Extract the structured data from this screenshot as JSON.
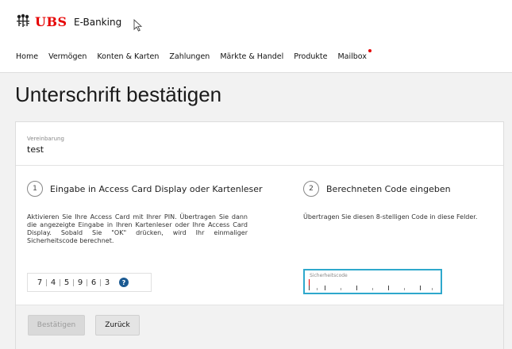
{
  "header": {
    "logo_text": "UBS",
    "app_name": "E-Banking",
    "brand_color": "#e60000"
  },
  "nav": {
    "items": [
      "Home",
      "Vermögen",
      "Konten & Karten",
      "Zahlungen",
      "Märkte & Handel",
      "Produkte",
      "Mailbox"
    ]
  },
  "page": {
    "title": "Unterschrift bestätigen"
  },
  "agreement": {
    "label": "Vereinbarung",
    "value": "test"
  },
  "step1": {
    "number": "1",
    "title": "Eingabe in Access Card Display oder Kartenleser",
    "text": "Aktivieren Sie Ihre Access Card mit Ihrer PIN. Übertragen Sie dann die angezeigte Eingabe in Ihren Kartenleser oder Ihre Access Card Display. Sobald Sie \"OK\" drücken, wird Ihr einmaliger Sicherheitscode berechnet.",
    "digits": [
      "7",
      "4",
      "5",
      "9",
      "6",
      "3"
    ],
    "help_icon": "question-circle-icon"
  },
  "step2": {
    "number": "2",
    "title": "Berechneten Code eingeben",
    "text": "Übertragen Sie diesen 8-stelligen Code in diese Felder.",
    "field_label": "Sicherheitscode",
    "field_value": ""
  },
  "buttons": {
    "confirm": "Bestätigen",
    "back": "Zurück"
  },
  "colors": {
    "focus": "#2ea8cc",
    "help": "#1b5a92"
  }
}
